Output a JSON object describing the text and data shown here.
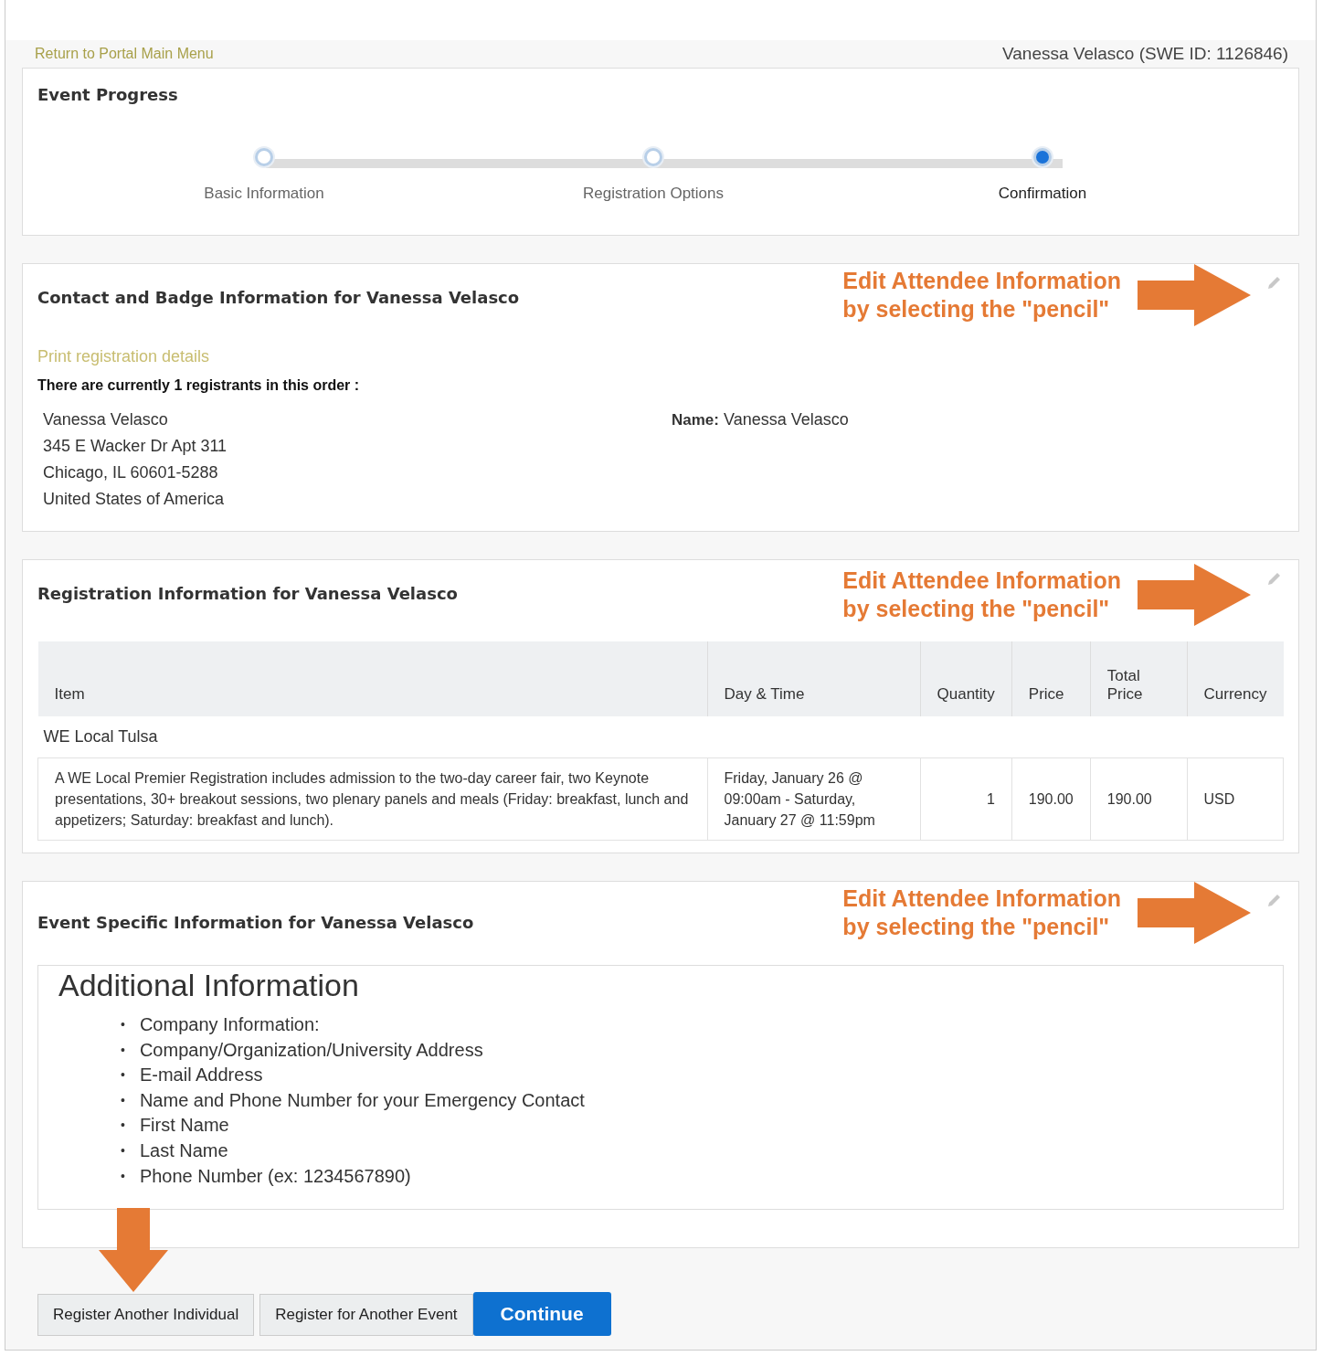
{
  "top_bar": {
    "return_link": "Return to Portal Main Menu",
    "user": "Vanessa Velasco (SWE ID: 1126846)"
  },
  "progress": {
    "title": "Event Progress",
    "steps": [
      {
        "label": "Basic Information",
        "selected": false
      },
      {
        "label": "Registration Options",
        "selected": false
      },
      {
        "label": "Confirmation",
        "selected": true
      }
    ]
  },
  "contact": {
    "title": "Contact and Badge Information for Vanessa Velasco",
    "callout": [
      "Edit Attendee Information",
      "by selecting the \"pencil\""
    ],
    "print_link": "Print registration details",
    "count_text": "There are currently 1 registrants in this order :",
    "address": [
      "Vanessa Velasco",
      "345 E Wacker Dr Apt 311",
      "Chicago, IL 60601-5288",
      "United States of America"
    ],
    "name_label": "Name:",
    "name_value": "Vanessa Velasco"
  },
  "registration": {
    "title": "Registration Information for Vanessa Velasco",
    "callout": [
      "Edit Attendee Information",
      "by selecting the \"pencil\""
    ],
    "columns": [
      "Item",
      "Day & Time",
      "Quantity",
      "Price",
      "Total Price",
      "Currency"
    ],
    "group": "WE Local Tulsa",
    "rows": [
      {
        "item": "A WE Local Premier Registration includes admission to the two-day career fair, two Keynote presentations, 30+ breakout sessions, two plenary panels and meals (Friday: breakfast, lunch and appetizers; Saturday: breakfast and lunch).",
        "day_time": "Friday, January 26 @ 09:00am - Saturday, January 27 @ 11:59pm",
        "quantity": "1",
        "price": "190.00",
        "total_price": "190.00",
        "currency": "USD"
      }
    ]
  },
  "event_specific": {
    "title": "Event Specific Information for Vanessa Velasco",
    "callout": [
      "Edit Attendee Information",
      "by selecting the \"pencil\""
    ],
    "heading": "Additional Information",
    "bullet": "•",
    "items": [
      "Company Information:",
      "Company/Organization/University Address",
      "E-mail Address",
      "Name and Phone Number for your Emergency Contact",
      "First Name",
      "Last Name",
      "Phone Number (ex: 1234567890)"
    ]
  },
  "buttons": [
    {
      "label": "Register Another Individual",
      "kind": "secondary"
    },
    {
      "label": "Register for Another Event",
      "kind": "secondary"
    },
    {
      "label": "Continue",
      "kind": "primary"
    }
  ]
}
